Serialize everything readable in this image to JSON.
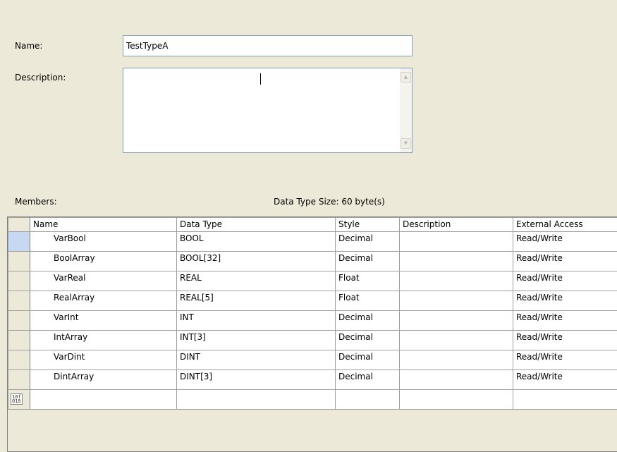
{
  "form": {
    "name_label": "Name:",
    "name_value": "TestTypeA",
    "description_label": "Description:",
    "description_value": "",
    "members_label": "Members:",
    "data_type_size": "Data Type Size: 60 byte(s)"
  },
  "members": {
    "columns": [
      "Name",
      "Data Type",
      "Style",
      "Description",
      "External Access"
    ],
    "rows": [
      {
        "name": "VarBool",
        "data_type": "BOOL",
        "style": "Decimal",
        "description": "",
        "external_access": "Read/Write"
      },
      {
        "name": "BoolArray",
        "data_type": "BOOL[32]",
        "style": "Decimal",
        "description": "",
        "external_access": "Read/Write"
      },
      {
        "name": "VarReal",
        "data_type": "REAL",
        "style": "Float",
        "description": "",
        "external_access": "Read/Write"
      },
      {
        "name": "RealArray",
        "data_type": "REAL[5]",
        "style": "Float",
        "description": "",
        "external_access": "Read/Write"
      },
      {
        "name": "VarInt",
        "data_type": "INT",
        "style": "Decimal",
        "description": "",
        "external_access": "Read/Write"
      },
      {
        "name": "IntArray",
        "data_type": "INT[3]",
        "style": "Decimal",
        "description": "",
        "external_access": "Read/Write"
      },
      {
        "name": "VarDint",
        "data_type": "DINT",
        "style": "Decimal",
        "description": "",
        "external_access": "Read/Write"
      },
      {
        "name": "DintArray",
        "data_type": "DINT[3]",
        "style": "Decimal",
        "description": "",
        "external_access": "Read/Write"
      }
    ],
    "new_row_icon": "new-row-icon"
  },
  "colors": {
    "window_bg": "#ece9d8",
    "field_border": "#7f9db9",
    "selected_row_header": "#c7d8f2"
  }
}
